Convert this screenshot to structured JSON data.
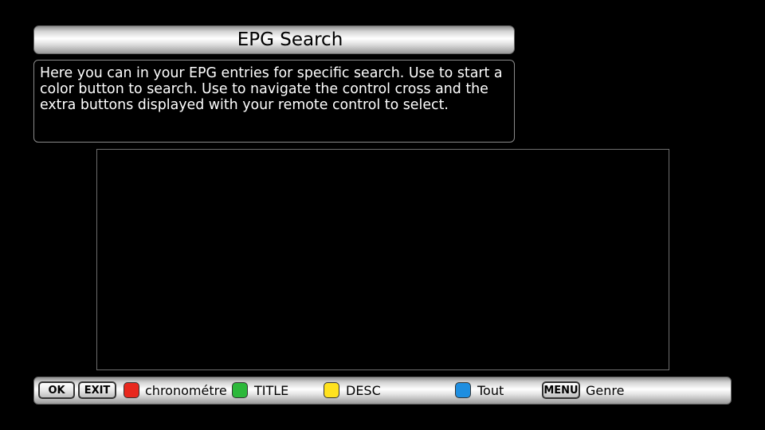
{
  "header": {
    "title": "EPG Search"
  },
  "info": {
    "text": "Here you can in your EPG entries for specific search. Use to start a color button to search. Use to navigate the control cross and the extra buttons displayed with your remote control to select."
  },
  "footer": {
    "ok_label": "OK",
    "exit_label": "EXIT",
    "red_label": "chronométre",
    "green_label": "TITLE",
    "yellow_label": "DESC",
    "blue_label": "Tout",
    "menu_label": "MENU",
    "menu_action": "Genre"
  },
  "colors": {
    "red": "#e8281e",
    "green": "#2cb83a",
    "yellow": "#ffe21e",
    "blue": "#1e8ee0"
  }
}
